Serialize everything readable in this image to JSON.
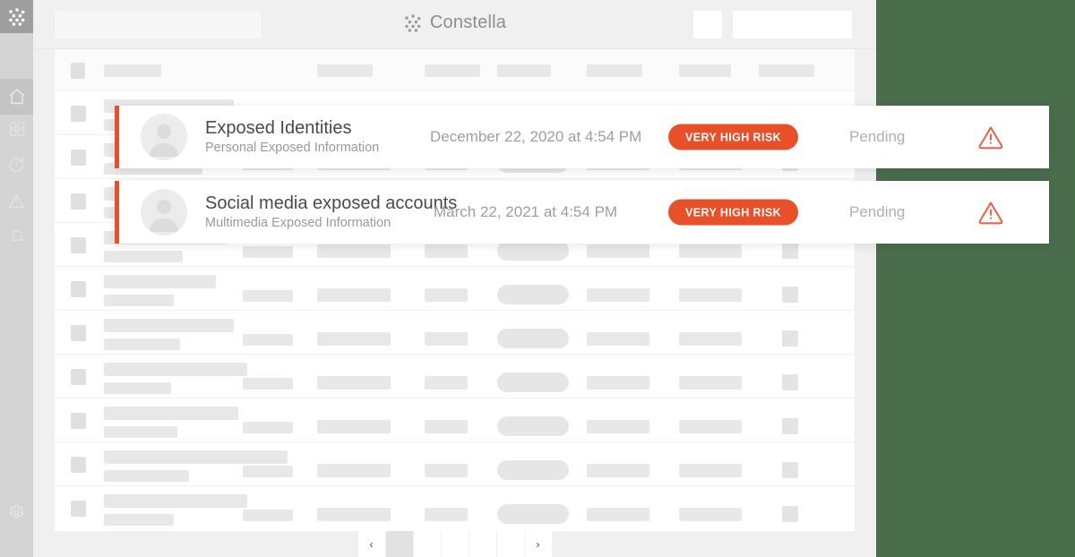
{
  "brand": {
    "name": "Constella",
    "logo_icon": "dots-grid-icon",
    "logo_color": "#8e8e8e"
  },
  "colors": {
    "accent_orange": "#e8502a",
    "warning_outline": "#e46a50",
    "page_background": "#4a6d4c",
    "app_chrome": "#f0f0f0",
    "rail": "#d4d4d4",
    "skeleton": "#e8e8e8"
  },
  "sidebar": {
    "logo_icon": "dots-grid-icon",
    "items": [
      {
        "icon": "home-icon",
        "name": "sidebar-item-home",
        "active": true
      },
      {
        "icon": "grid-dashboard-icon",
        "name": "sidebar-item-dashboard",
        "active": false
      },
      {
        "icon": "clock-history-icon",
        "name": "sidebar-item-history",
        "active": false
      },
      {
        "icon": "warning-triangle-icon",
        "name": "sidebar-item-alerts",
        "active": false
      },
      {
        "icon": "bell-icon",
        "name": "sidebar-item-notifications",
        "active": false
      }
    ],
    "footer_item": {
      "icon": "gear-icon",
      "name": "sidebar-item-settings"
    }
  },
  "topbar": {
    "search_placeholder": "",
    "search_value": "",
    "small_box_label": "",
    "large_box_label": ""
  },
  "table": {
    "header_skeleton_columns": 7,
    "skeleton_rows": 10
  },
  "alerts": [
    {
      "title": "Exposed Identities",
      "subtitle": "Personal Exposed Information",
      "date": "December 22, 2020 at 4:54 PM",
      "risk_label": "VERY HIGH RISK",
      "status": "Pending",
      "avatar_icon": "user-avatar-icon",
      "warning_icon": "warning-triangle-icon",
      "accent_color": "#e8502a"
    },
    {
      "title": "Social media exposed accounts",
      "subtitle": "Multimedia Exposed Information",
      "date": "March 22, 2021 at 4:54 PM",
      "risk_label": "VERY HIGH RISK",
      "status": "Pending",
      "avatar_icon": "user-avatar-icon",
      "warning_icon": "warning-triangle-icon",
      "accent_color": "#e8502a"
    }
  ],
  "pagination": {
    "prev_label": "‹",
    "next_label": "›",
    "pages": [
      "",
      "",
      "",
      "",
      ""
    ],
    "active_index": 0
  }
}
